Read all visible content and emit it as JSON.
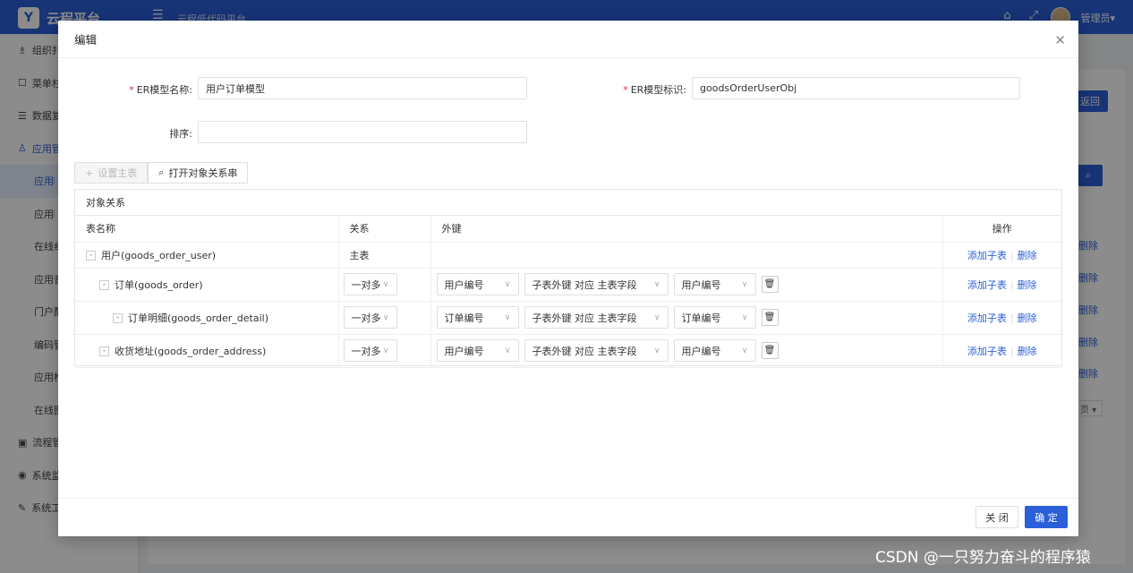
{
  "app": {
    "name": "云程平台",
    "subtitle": "云程低代码平台",
    "user": "管理员▾"
  },
  "sidebar": {
    "items": [
      {
        "icon": "org-icon",
        "label": "组织扌"
      },
      {
        "icon": "menu-icon",
        "label": "菜单杉"
      },
      {
        "icon": "data-icon",
        "label": "数据复"
      },
      {
        "icon": "app-icon",
        "label": "应用管"
      },
      {
        "label": "应用𝄀"
      },
      {
        "label": "应用𝄀"
      },
      {
        "label": "在线纟"
      },
      {
        "label": "应用音"
      },
      {
        "label": "门户酊"
      },
      {
        "label": "编码管"
      },
      {
        "label": "应用柞"
      },
      {
        "label": "在线图"
      },
      {
        "icon": "flow-icon",
        "label": "流程管"
      },
      {
        "icon": "eye-icon",
        "label": "系统监"
      },
      {
        "icon": "wrench-icon",
        "label": "系统工"
      }
    ]
  },
  "background": {
    "back_label": "返回",
    "delete_label": "删除",
    "page_label": "页 ▾"
  },
  "modal": {
    "title": "编辑",
    "fields": {
      "er_name_label": "ER模型名称:",
      "er_name_value": "用户订单模型",
      "er_id_label": "ER模型标识:",
      "er_id_value": "goodsOrderUserObj",
      "sort_label": "排序:",
      "sort_value": ""
    },
    "toolbar": {
      "set_main": "设置主表",
      "open_relation": "打开对象关系串"
    },
    "relation_title": "对象关系",
    "table": {
      "headers": [
        "表名称",
        "关系",
        "外键",
        "操作"
      ],
      "rows": [
        {
          "name": "用户(goods_order_user)",
          "relation": "主表"
        },
        {
          "name": "订单(goods_order)",
          "relation": "一对多",
          "fk1": "用户编号",
          "fk_map": "子表外键 对应 主表字段",
          "fk2": "用户编号"
        },
        {
          "name": "订单明细(goods_order_detail)",
          "relation": "一对多",
          "fk1": "订单编号",
          "fk_map": "子表外键 对应 主表字段",
          "fk2": "订单编号"
        },
        {
          "name": "收货地址(goods_order_address)",
          "relation": "一对多",
          "fk1": "用户编号",
          "fk_map": "子表外键 对应 主表字段",
          "fk2": "用户编号"
        }
      ],
      "add_child": "添加子表",
      "delete": "删除"
    },
    "footer": {
      "close": "关 闭",
      "ok": "确 定"
    }
  },
  "watermark": "CSDN @一只努力奋斗的程序猿"
}
